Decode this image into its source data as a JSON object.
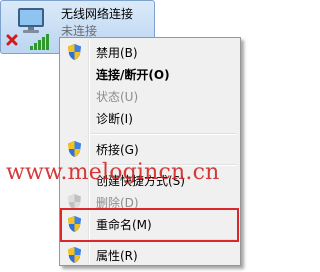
{
  "connection": {
    "name": "无线网络连接",
    "status": "未连接"
  },
  "menu": {
    "items": [
      {
        "label": "禁用(B)",
        "icon": "shield-icon"
      },
      {
        "label": "连接/断开(O)",
        "bold": true
      },
      {
        "label": "状态(U)",
        "disabled": true
      },
      {
        "label": "诊断(I)"
      },
      {
        "label": "桥接(G)",
        "icon": "shield-icon"
      },
      {
        "label": "创建快捷方式(S)"
      },
      {
        "label": "删除(D)",
        "icon": "shield-icon",
        "disabled": true
      },
      {
        "label": "重命名(M)",
        "icon": "shield-icon"
      },
      {
        "label": "属性(R)",
        "icon": "shield-icon"
      }
    ]
  },
  "watermark": "www.melogincn.cn",
  "colors": {
    "tile_bg": "#c9def5",
    "highlight": "#d9282a",
    "watermark": "#d12a2a"
  }
}
